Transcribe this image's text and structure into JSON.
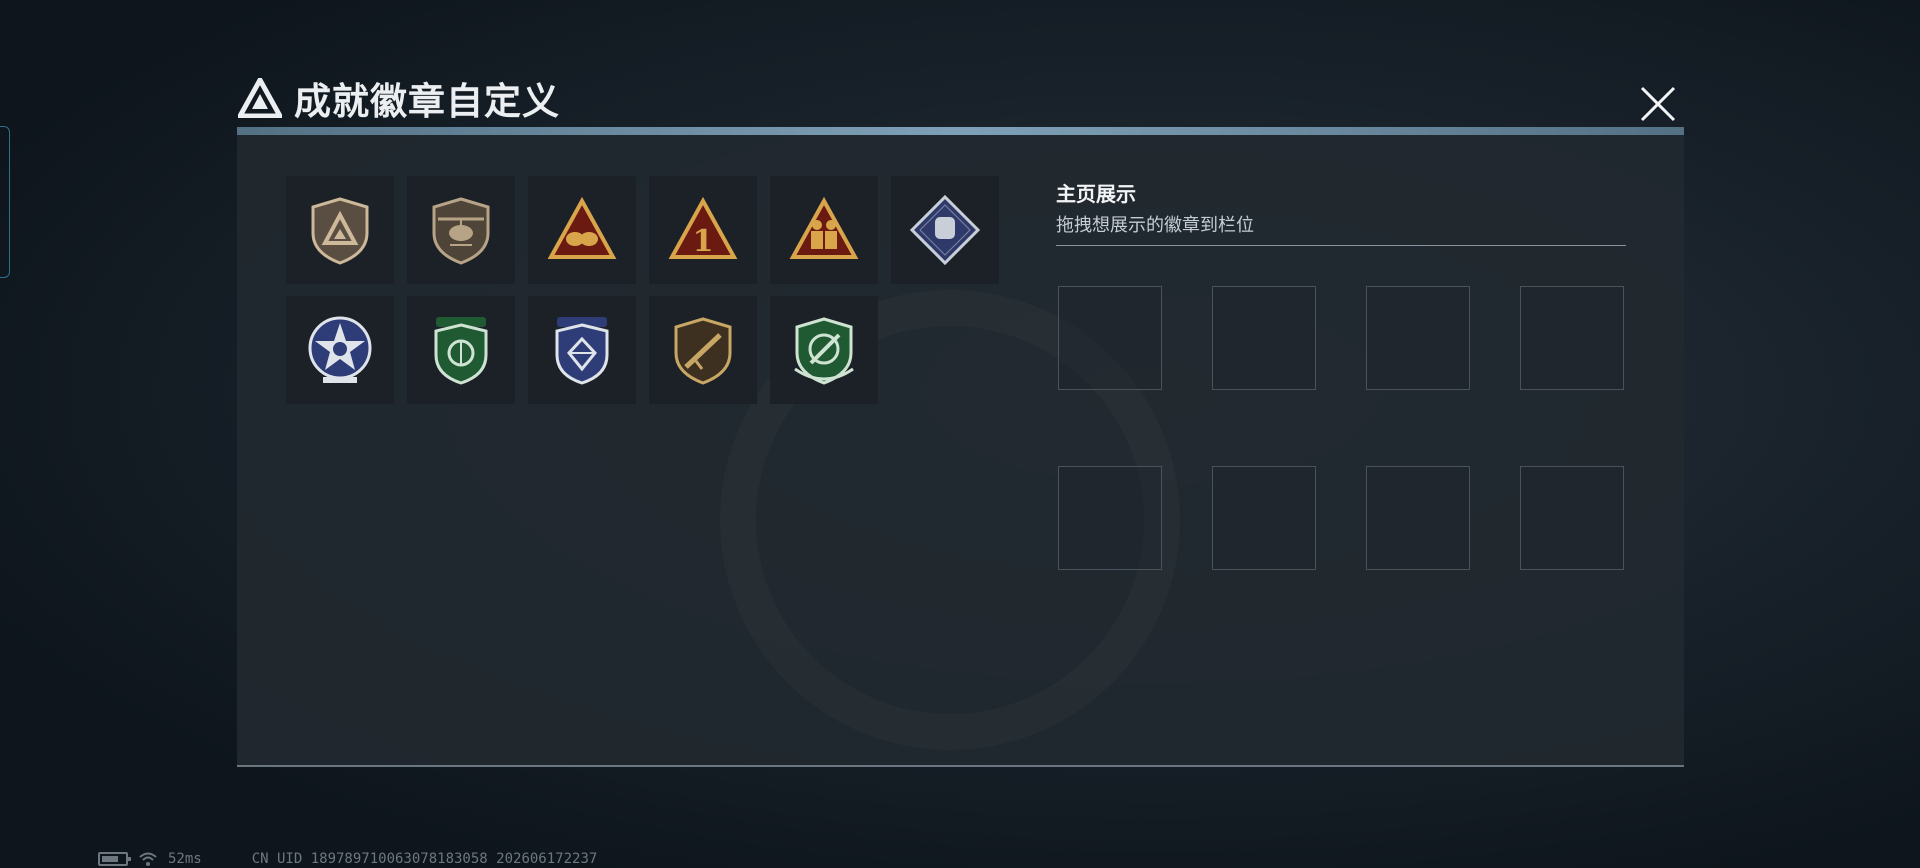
{
  "window": {
    "title": "成就徽章自定义",
    "close_label": "close"
  },
  "badges": [
    {
      "name": "triangle-logo-badge",
      "kind": "shield-triangle",
      "colors": [
        "#5a4e42",
        "#cdb89a"
      ]
    },
    {
      "name": "helicopter-badge",
      "kind": "shield-helicopter",
      "colors": [
        "#4e4438",
        "#b7a487"
      ]
    },
    {
      "name": "hands-triangle-badge",
      "kind": "triangle-hands",
      "colors": [
        "#6b1a12",
        "#d9a54a"
      ]
    },
    {
      "name": "number-one-badge",
      "kind": "triangle-number",
      "colors": [
        "#6b1a12",
        "#d9a54a"
      ],
      "text": "1"
    },
    {
      "name": "soldiers-triangle-badge",
      "kind": "triangle-soldiers",
      "colors": [
        "#6b1a12",
        "#d9a54a"
      ]
    },
    {
      "name": "fist-diamond-badge",
      "kind": "diamond-fist",
      "colors": [
        "#2f3a6b",
        "#c9cfd9"
      ]
    },
    {
      "name": "star-wreath-badge",
      "kind": "circle-star",
      "colors": [
        "#2e3d77",
        "#dfe3ea"
      ]
    },
    {
      "name": "green-shield-badge",
      "kind": "shield-green",
      "colors": [
        "#1f5a33",
        "#cfe3d3"
      ]
    },
    {
      "name": "diamond-shield-badge",
      "kind": "shield-diamond",
      "colors": [
        "#2e3d77",
        "#dfe3ea"
      ]
    },
    {
      "name": "rifle-shield-badge",
      "kind": "shield-rifle",
      "colors": [
        "#3d3020",
        "#c8a765"
      ]
    },
    {
      "name": "crosshair-shield-badge",
      "kind": "shield-crosshair",
      "colors": [
        "#1f5a33",
        "#cfe3d3"
      ]
    }
  ],
  "showcase": {
    "title": "主页展示",
    "subtitle": "拖拽想展示的徽章到栏位",
    "slot_count": 8
  },
  "status": {
    "ping": "52ms",
    "uid": "CN UID 1897897100630781830​58 202606172237"
  },
  "colors": {
    "background": "#0f161d",
    "panel": "#222930",
    "accent_bar": "#8fb6cf",
    "slot_border": "#4a535c"
  }
}
